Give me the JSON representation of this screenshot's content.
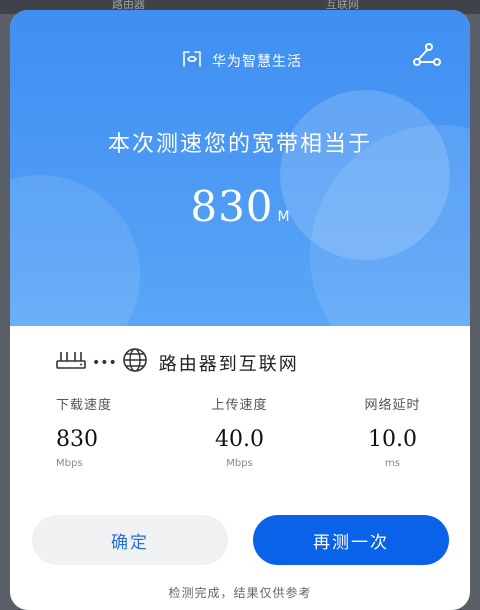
{
  "background": {
    "left_text": "路由器",
    "right_text": "互联网"
  },
  "brand": {
    "name": "华为智慧生活",
    "icon": "huawei-smart-life-logo-icon"
  },
  "header": {
    "share_icon": "share-icon"
  },
  "result": {
    "headline": "本次测速您的宽带相当于",
    "speed_value": "830",
    "speed_unit": "M"
  },
  "route": {
    "router_icon": "router-icon",
    "globe_icon": "globe-icon",
    "label": "路由器到互联网"
  },
  "metrics": [
    {
      "label": "下载速度",
      "value": "830",
      "unit": "Mbps"
    },
    {
      "label": "上传速度",
      "value": "40.0",
      "unit": "Mbps"
    },
    {
      "label": "网络延时",
      "value": "10.0",
      "unit": "ms"
    }
  ],
  "buttons": {
    "confirm": "确定",
    "retest": "再测一次"
  },
  "footer": {
    "note": "检测完成，结果仅供参考"
  },
  "colors": {
    "hero_blue": "#4a98f4",
    "primary_button": "#0a62e8",
    "secondary_button_bg": "#f0f1f3",
    "secondary_button_text": "#2a6fd6"
  }
}
